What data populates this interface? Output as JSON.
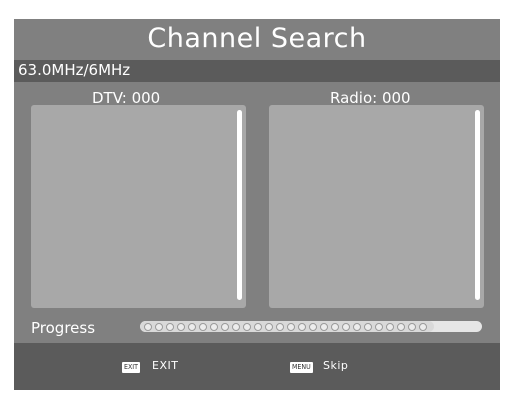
{
  "title": "Channel Search",
  "frequency": "63.0MHz/6MHz",
  "dtv_label": "DTV: 000",
  "radio_label": "Radio: 000",
  "progress": {
    "label": "Progress",
    "fraction": 0.86
  },
  "footer": {
    "exit_key": "EXIT",
    "exit_label": "EXIT",
    "menu_key": "MENU",
    "skip_label": "Skip"
  },
  "colors": {
    "background": "#808080",
    "bar": "#5b5b5b",
    "panel": "#a8a8a8",
    "text": "#ffffff"
  }
}
